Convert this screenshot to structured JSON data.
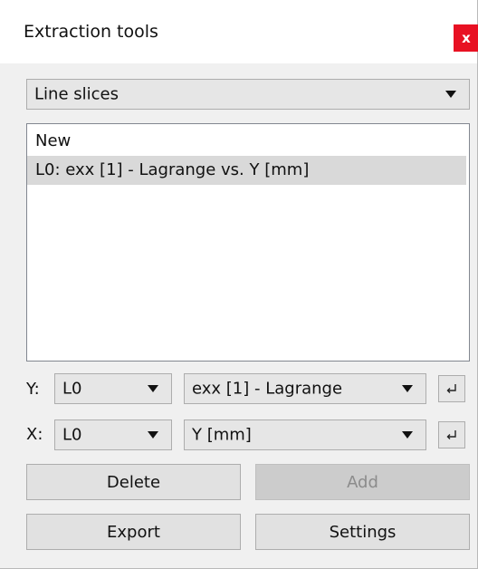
{
  "window": {
    "title": "Extraction tools",
    "close_label": "x"
  },
  "mode_select": {
    "selected": "Line slices"
  },
  "list": {
    "items": [
      "New",
      "L0: exx [1] - Lagrange vs. Y [mm]"
    ],
    "selected_index": 1
  },
  "y_row": {
    "label": "Y:",
    "line": "L0",
    "variable": "exx [1] - Lagrange"
  },
  "x_row": {
    "label": "X:",
    "line": "L0",
    "variable": "Y [mm]"
  },
  "buttons": {
    "delete": "Delete",
    "add": "Add",
    "export": "Export",
    "settings": "Settings"
  },
  "icons": {
    "close": "close-icon",
    "dropdown": "chevron-down-icon",
    "enter": "enter-icon"
  },
  "colors": {
    "close_bg": "#e81123",
    "selection_bg": "#d9d9d9"
  }
}
